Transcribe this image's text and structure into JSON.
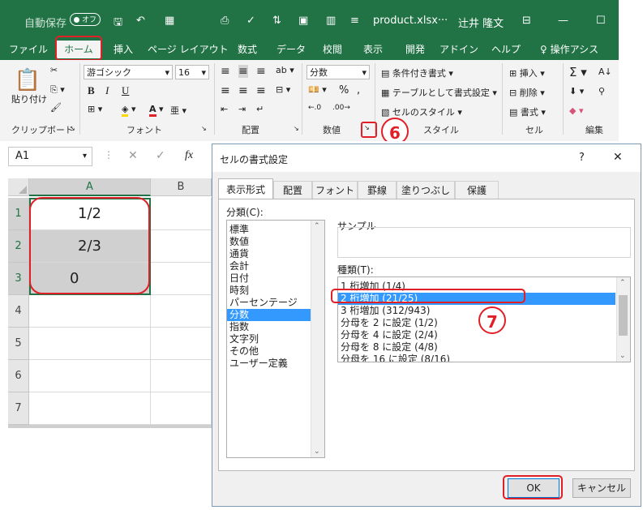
{
  "titlebar": {
    "autosave": "自動保存",
    "autosave_state": "オフ",
    "filename": "product.xlsx···",
    "user": "辻井 隆文"
  },
  "tabs": [
    "ファイル",
    "ホーム",
    "挿入",
    "ページ レイアウト",
    "数式",
    "データ",
    "校閲",
    "表示",
    "開発",
    "アドイン",
    "ヘルプ",
    "操作アシス"
  ],
  "ribbon": {
    "clipboard": {
      "paste": "貼り付け",
      "label": "クリップボード"
    },
    "font": {
      "name": "游ゴシック",
      "size": "16",
      "bold": "B",
      "italic": "I",
      "underline": "U",
      "label": "フォント"
    },
    "alignment": {
      "label": "配置"
    },
    "number": {
      "format": "分数",
      "label": "数値"
    },
    "styles": {
      "conditional": "条件付き書式",
      "table": "テーブルとして書式設定",
      "cell_styles": "セルのスタイル",
      "label": "スタイル"
    },
    "cells": {
      "insert": "挿入",
      "delete": "削除",
      "format": "書式",
      "label": "セル"
    },
    "editing": {
      "label": "編集"
    }
  },
  "formula": {
    "namebox": "A1",
    "fx": "fx"
  },
  "grid": {
    "columns": [
      "A",
      "B"
    ],
    "rows": [
      "1",
      "2",
      "3",
      "4",
      "5",
      "6",
      "7"
    ],
    "cells": [
      "1/2",
      "2/3",
      "0"
    ]
  },
  "dialog": {
    "title": "セルの書式設定",
    "help": "?",
    "close": "✕",
    "tabs": [
      "表示形式",
      "配置",
      "フォント",
      "罫線",
      "塗りつぶし",
      "保護"
    ],
    "category_label": "分類(C):",
    "categories": [
      "標準",
      "数値",
      "通貨",
      "会計",
      "日付",
      "時刻",
      "パーセンテージ",
      "分数",
      "指数",
      "文字列",
      "その他",
      "ユーザー定義"
    ],
    "selected_category": "分数",
    "sample_label": "サンプル",
    "type_label": "種類(T):",
    "types": [
      "1 桁増加 (1/4)",
      "2 桁増加 (21/25)",
      "3 桁増加 (312/943)",
      "分母を 2 に設定 (1/2)",
      "分母を 4 に設定 (2/4)",
      "分母を 8 に設定 (4/8)",
      "分母を 16 に設定 (8/16)"
    ],
    "selected_type": "2 桁増加 (21/25)",
    "ok": "OK",
    "cancel": "キャンセル"
  },
  "callouts": [
    "6",
    "7"
  ],
  "colors": {
    "excel_green": "#217346",
    "highlight_red": "#e01f26",
    "selection_blue": "#3399ff"
  }
}
